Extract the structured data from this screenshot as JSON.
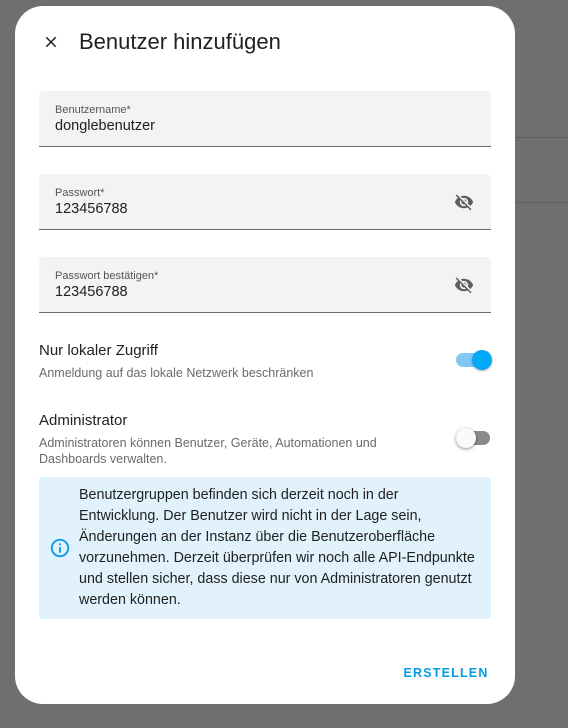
{
  "dialog": {
    "title": "Benutzer hinzufügen",
    "close_icon": "close-icon"
  },
  "fields": {
    "username": {
      "label": "Benutzername*",
      "value": "donglebenutzer"
    },
    "password": {
      "label": "Passwort*",
      "value": "123456788",
      "toggle_icon": "eye-off-icon"
    },
    "password_confirm": {
      "label": "Passwort bestätigen*",
      "value": "123456788",
      "toggle_icon": "eye-off-icon"
    }
  },
  "settings": {
    "local_only": {
      "title": "Nur lokaler Zugriff",
      "description": "Anmeldung auf das lokale Netzwerk beschränken",
      "enabled": true
    },
    "admin": {
      "title": "Administrator",
      "description": "Administratoren können Benutzer, Geräte, Automationen und Dashboards verwalten.",
      "enabled": false
    }
  },
  "alert": {
    "icon": "info-icon",
    "text": "Benutzergruppen befinden sich derzeit noch in der Entwicklung. Der Benutzer wird nicht in der Lage sein, Änderungen an der Instanz über die Benutzeroberfläche vorzunehmen. Derzeit überprüfen wir noch alle API-Endpunkte und stellen sicher, dass diese nur von Administratoren genutzt werden können."
  },
  "actions": {
    "create_label": "ERSTELLEN"
  },
  "colors": {
    "accent": "#03a9f4",
    "alert_bg": "#e1f2fc",
    "backdrop": "#6f6f6f"
  }
}
